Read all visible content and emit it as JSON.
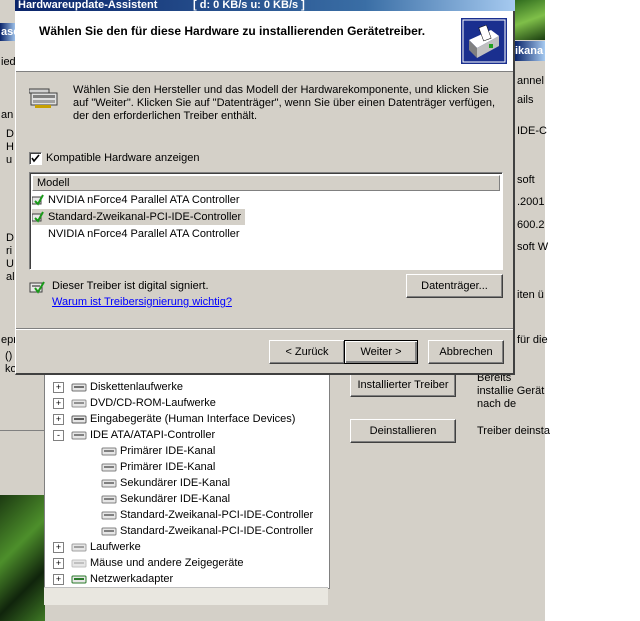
{
  "dialog": {
    "title": "Hardwareupdate-Assistent",
    "title_stats": "[ d: 0 KB/s    u: 0 KB/s ]",
    "header": "Wählen Sie den für diese Hardware zu installierenden Gerätetreiber.",
    "instruction": "Wählen Sie den Hersteller und das Modell der Hardwarekomponente, und klicken Sie auf \"Weiter\". Klicken Sie auf \"Datenträger\", wenn Sie über einen Datenträger verfügen, der den erforderlichen Treiber enthält.",
    "compatible_checkbox_label": "Kompatible Hardware anzeigen",
    "compatible_checked": true,
    "list_header": "Modell",
    "models": [
      {
        "label": "NVIDIA nForce4 Parallel ATA Controller",
        "signed": true,
        "selected": false
      },
      {
        "label": "Standard-Zweikanal-PCI-IDE-Controller",
        "signed": true,
        "selected": true
      },
      {
        "label": "NVIDIA nForce4 Parallel ATA Controller",
        "signed": false,
        "selected": false
      }
    ],
    "signed_text": "Dieser Treiber ist digital signiert.",
    "signing_link": "Warum ist Treibersignierung wichtig?",
    "have_disk_button": "Datenträger...",
    "back_button": "< Zurück",
    "next_button": "Weiter >",
    "cancel_button": "Abbrechen"
  },
  "device_tree": [
    {
      "label": "Diskettenlaufwerke",
      "toggle": "+",
      "level": 0,
      "icon": "floppy-icon"
    },
    {
      "label": "DVD/CD-ROM-Laufwerke",
      "toggle": "+",
      "level": 0,
      "icon": "cdrom-icon"
    },
    {
      "label": "Eingabegeräte (Human Interface Devices)",
      "toggle": "+",
      "level": 0,
      "icon": "hid-icon"
    },
    {
      "label": "IDE ATA/ATAPI-Controller",
      "toggle": "-",
      "level": 0,
      "icon": "ide-controller-icon"
    },
    {
      "label": "Primärer IDE-Kanal",
      "toggle": "",
      "level": 1,
      "icon": "ide-channel-icon"
    },
    {
      "label": "Primärer IDE-Kanal",
      "toggle": "",
      "level": 1,
      "icon": "ide-channel-icon"
    },
    {
      "label": "Sekundärer IDE-Kanal",
      "toggle": "",
      "level": 1,
      "icon": "ide-channel-icon"
    },
    {
      "label": "Sekundärer IDE-Kanal",
      "toggle": "",
      "level": 1,
      "icon": "ide-channel-icon"
    },
    {
      "label": "Standard-Zweikanal-PCI-IDE-Controller",
      "toggle": "",
      "level": 1,
      "icon": "ide-channel-icon"
    },
    {
      "label": "Standard-Zweikanal-PCI-IDE-Controller",
      "toggle": "",
      "level": 1,
      "icon": "ide-channel-icon"
    },
    {
      "label": "Laufwerke",
      "toggle": "+",
      "level": 0,
      "icon": "drive-icon"
    },
    {
      "label": "Mäuse und andere Zeigegeräte",
      "toggle": "+",
      "level": 0,
      "icon": "mouse-icon"
    },
    {
      "label": "Netzwerkadapter",
      "toggle": "+",
      "level": 0,
      "icon": "network-icon"
    }
  ],
  "properties": {
    "installed_driver_button": "Installierter Treiber",
    "installed_driver_desc": "Bereits installie Gerät nach de ordnungsgemä",
    "uninstall_button": "Deinstallieren",
    "uninstall_desc": "Treiber deinsta"
  },
  "background_fragments": {
    "left_title": "asc",
    "left_1": "ied",
    "left_2": "an",
    "left_col_a": [
      "D",
      "H",
      "u"
    ],
    "left_col_b": [
      "D",
      "ri",
      "U",
      "al"
    ],
    "left_3": "epr",
    "left_4": "()",
    "left_5": "ko",
    "right_title": "ikana",
    "right_lines": [
      "annel",
      "ails",
      "IDE-C",
      "soft",
      ".2001",
      "600.2",
      "soft W",
      "iten ü",
      "für die"
    ]
  }
}
